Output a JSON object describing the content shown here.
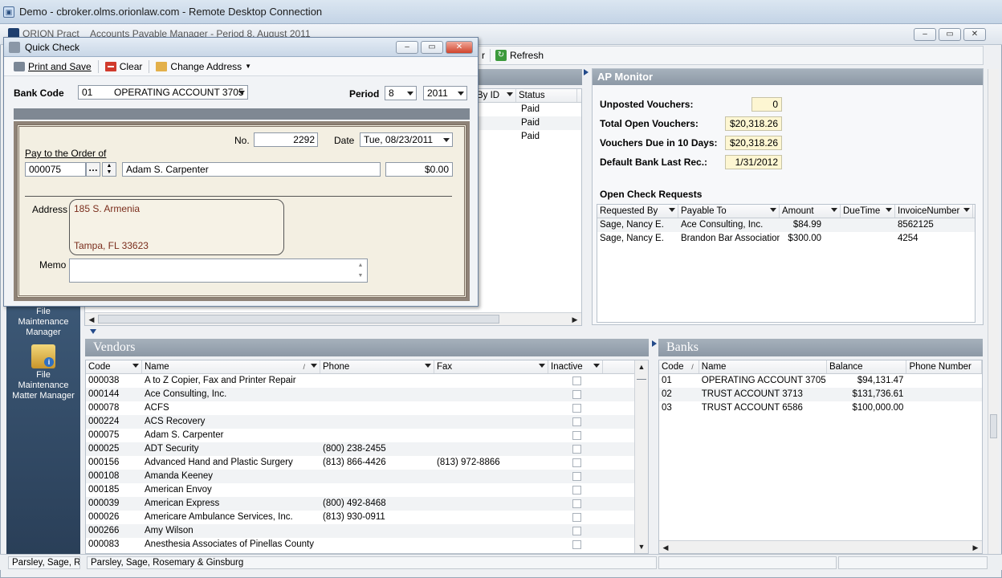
{
  "rdp": {
    "title": "Demo - cbroker.olms.orionlaw.com - Remote Desktop Connection"
  },
  "app": {
    "title_partial": "ORION Pract",
    "doc_title": "Accounts Payable Manager - Period 8, August 2011"
  },
  "toolbar2": {
    "partial": "r",
    "refresh": "Refresh"
  },
  "quick_check": {
    "title": "Quick Check",
    "toolbar": {
      "print_save": "Print and Save",
      "clear": "Clear",
      "change_address": "Change Address"
    },
    "bank_code_label": "Bank Code",
    "bank_code": "01",
    "bank_name": "OPERATING ACCOUNT 3705",
    "period_label": "Period",
    "period": "8",
    "year": "2011",
    "no_label": "No.",
    "check_no": "2292",
    "date_label": "Date",
    "date": "Tue, 08/23/2011",
    "pay_label": "Pay to the Order of",
    "payee_code": "000075",
    "payee_name": "Adam S. Carpenter",
    "amount": "$0.00",
    "address_label": "Address",
    "address_line1": "185 S. Armenia",
    "address_line2": "Tampa, FL 33623",
    "memo_label": "Memo",
    "memo": ""
  },
  "bg_grid": {
    "columns": [
      "By ID",
      "Status"
    ],
    "rows": [
      "Paid",
      "Paid",
      "Paid"
    ]
  },
  "nav": {
    "item1": [
      "File",
      "Maintenance",
      "Manager"
    ],
    "item2": [
      "File",
      "Maintenance",
      "Matter Manager"
    ]
  },
  "ap_monitor": {
    "title": "AP Monitor",
    "unposted_label": "Unposted Vouchers:",
    "unposted": "0",
    "total_open_label": "Total Open Vouchers:",
    "total_open": "$20,318.26",
    "due10_label": "Vouchers Due in 10 Days:",
    "due10": "$20,318.26",
    "bank_rec_label": "Default Bank Last Rec.:",
    "bank_rec": "1/31/2012",
    "open_check_title": "Open Check Requests",
    "columns": [
      "Requested By",
      "Payable To",
      "Amount",
      "DueTime",
      "InvoiceNumber"
    ],
    "rows": [
      [
        "Sage, Nancy E.",
        "Ace Consulting, Inc.",
        "$84.99",
        "",
        "8562125"
      ],
      [
        "Sage, Nancy E.",
        "Brandon Bar Association",
        "$300.00",
        "",
        "4254"
      ]
    ]
  },
  "vendors": {
    "title": "Vendors",
    "columns": [
      "Code",
      "Name",
      "Phone",
      "Fax",
      "Inactive"
    ],
    "rows": [
      [
        "000038",
        "A to Z Copier, Fax and Printer Repair",
        "",
        ""
      ],
      [
        "000144",
        "Ace Consulting, Inc.",
        "",
        ""
      ],
      [
        "000078",
        "ACFS",
        "",
        ""
      ],
      [
        "000224",
        "ACS Recovery",
        "",
        ""
      ],
      [
        "000075",
        "Adam S. Carpenter",
        "",
        ""
      ],
      [
        "000025",
        "ADT Security",
        "(800) 238-2455",
        ""
      ],
      [
        "000156",
        "Advanced Hand and Plastic Surgery",
        "(813) 866-4426",
        "(813) 972-8866"
      ],
      [
        "000108",
        "Amanda Keeney",
        "",
        ""
      ],
      [
        "000185",
        "American Envoy",
        "",
        ""
      ],
      [
        "000039",
        "American Express",
        "(800) 492-8468",
        ""
      ],
      [
        "000026",
        "Americare Ambulance Services, Inc.",
        "(813) 930-0911",
        ""
      ],
      [
        "000266",
        "Amy Wilson",
        "",
        ""
      ],
      [
        "000083",
        "Anesthesia Associates of Pinellas County",
        "",
        ""
      ]
    ]
  },
  "banks": {
    "title": "Banks",
    "columns": [
      "Code",
      "Name",
      "Balance",
      "Phone Number"
    ],
    "rows": [
      [
        "01",
        "OPERATING ACCOUNT 3705",
        "$94,131.47",
        ""
      ],
      [
        "02",
        "TRUST ACCOUNT 3713",
        "$131,736.61",
        ""
      ],
      [
        "03",
        "TRUST ACCOUNT 6586",
        "$100,000.00",
        ""
      ]
    ]
  },
  "status": {
    "left": "Parsley, Sage, Ro",
    "firm": "Parsley, Sage, Rosemary & Ginsburg"
  }
}
